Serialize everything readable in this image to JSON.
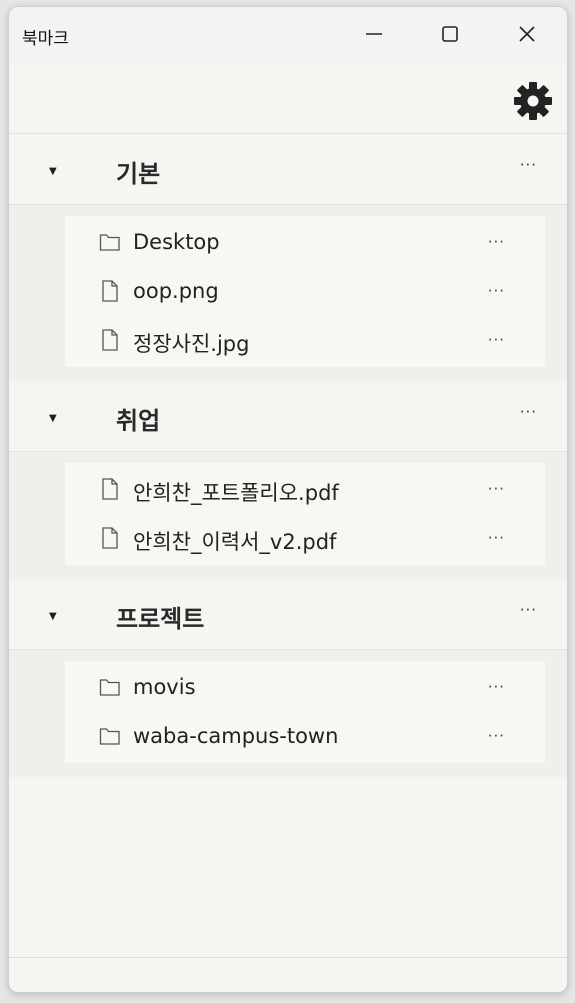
{
  "window": {
    "title": "북마크"
  },
  "toolbar": {
    "settings_icon": "gear-icon"
  },
  "groups": [
    {
      "name": "기본",
      "more": "···",
      "items": [
        {
          "label": "Desktop",
          "icon": "folder-icon",
          "more": "···"
        },
        {
          "label": "oop.png",
          "icon": "file-icon",
          "more": "···"
        },
        {
          "label": "정장사진.jpg",
          "icon": "file-icon",
          "more": "···"
        }
      ]
    },
    {
      "name": "취업",
      "more": "···",
      "items": [
        {
          "label": "안희찬_포트폴리오.pdf",
          "icon": "file-icon",
          "more": "···"
        },
        {
          "label": "안희찬_이력서_v2.pdf",
          "icon": "file-icon",
          "more": "···"
        }
      ]
    },
    {
      "name": "프로젝트",
      "more": "···",
      "items": [
        {
          "label": "movis",
          "icon": "folder-icon",
          "more": "···"
        },
        {
          "label": "waba-campus-town",
          "icon": "folder-icon",
          "more": "···"
        }
      ]
    }
  ]
}
